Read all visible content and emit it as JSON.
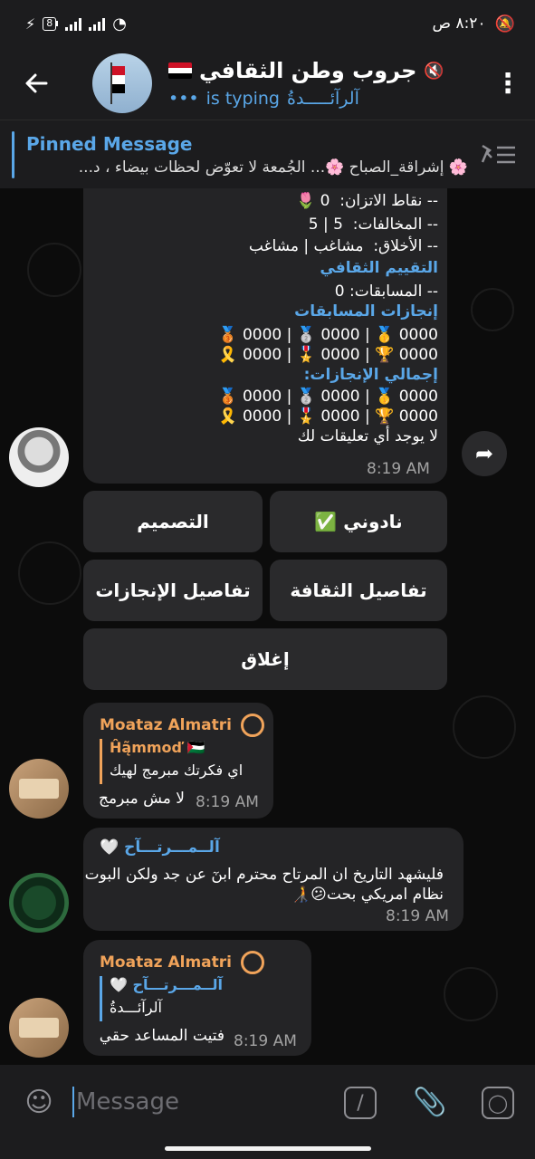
{
  "status_bar": {
    "time": "٨:٢٠ ص",
    "battery": "8",
    "icons": [
      "charging-icon",
      "battery-icon",
      "signal-icon",
      "signal-icon",
      "wifi-icon",
      "alarm-off-icon"
    ]
  },
  "header": {
    "title": "جروب وطن الثقافي",
    "flag": "🇾🇪",
    "typing_user": "آلرآئـــــدةُ",
    "typing_suffix": "is typing",
    "typing_dots": "•••"
  },
  "pinned": {
    "title": "Pinned Message",
    "text": "🌸 إشراقة_الصباح 🌸... الجُمعة لا تعوّض لحظات بيضاء ، د..."
  },
  "stats_message": {
    "lines": [
      {
        "label": "-- نقاط الاتزان:",
        "value": "0 🌷"
      },
      {
        "label": "-- المخالفات:",
        "value": "5 | 5"
      },
      {
        "label": "-- الأخلاق:",
        "value": "مشاغب | مشاغب"
      }
    ],
    "section_culture": "التقييم الثقافي",
    "competitions_line": "-- المسابقات:   0",
    "section_comp_achievements": "إنجازات المسابقات",
    "comp_row1": "0000 🥇 | 0000 🥈 | 0000 🥉",
    "comp_row2": "0000 🏆 | 0000 🎖️ | 0000 🎗️",
    "section_total": "إجمالي الإنجازات:",
    "total_row1": "0000 🥇 | 0000 🥈 | 0000 🥉",
    "total_row2": "0000 🏆 | 0000 🎖️ | 0000 🎗️",
    "no_comments": "لا يوجد أي تعليقات لك",
    "time": "8:19 AM"
  },
  "inline_keyboard": {
    "b1": "نادوني ✅",
    "b2": "التصميم",
    "b3": "تفاصيل الثقافة",
    "b4": "تفاصيل الإنجازات",
    "b5": "إغلاق"
  },
  "msg1": {
    "sender": "Moataz Almatri",
    "quote_author": "Ĥą̃mmoď 🇵🇸",
    "quote_text": "اي فكرتك مبرمج لهيك",
    "text": "لا مش مبرمج",
    "time": "8:19 AM"
  },
  "msg2": {
    "sender": "آلــمـــرتـــآح 🤍",
    "text_line1": "فليشهد التاريخ ان المرتاح محترم ابنٓ عن جد ولكن البوت",
    "text_line2": "نظام امريكي بحت😕🧑‍🦯",
    "time": "8:19 AM"
  },
  "msg3": {
    "sender": "Moataz Almatri",
    "quote_author": "آلــمـــرتـــآح 🤍",
    "quote_text": "آلرآئـــدةُ",
    "text": "فتيت المساعد حقي",
    "time": "8:19 AM"
  },
  "input": {
    "placeholder": "Message"
  },
  "colors": {
    "accent": "#5aa7e8",
    "sender_orange": "#f0a35a",
    "bubble": "#242426",
    "bar": "#1c1c1e"
  }
}
